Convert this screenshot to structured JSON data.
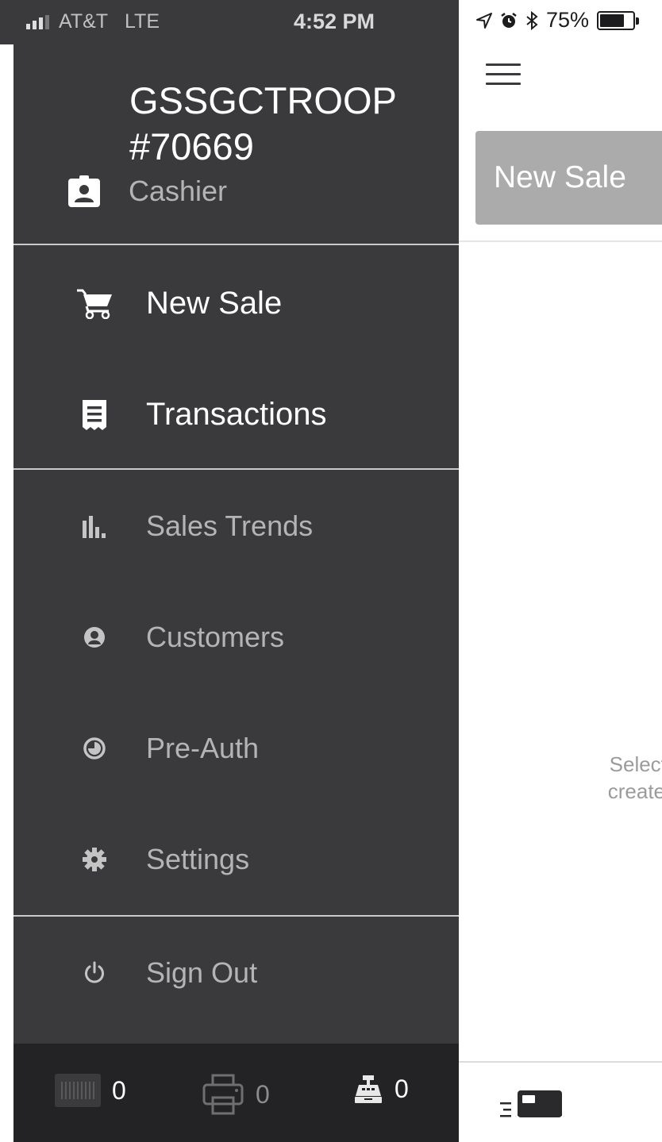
{
  "status_bar": {
    "carrier": "AT&T",
    "network": "LTE",
    "time": "4:52 PM",
    "battery_percent": "75%",
    "battery_level": 0.75
  },
  "main": {
    "active_tab": "New Sale",
    "hint_line1": "Select \"",
    "hint_line2": "create y"
  },
  "drawer": {
    "account_name": "GSSGCTROOP #70669",
    "role": "Cashier",
    "primary_items": [
      {
        "label": "New Sale",
        "icon": "cart-icon"
      },
      {
        "label": "Transactions",
        "icon": "receipt-icon"
      }
    ],
    "secondary_items": [
      {
        "label": "Sales Trends",
        "icon": "bar-chart-icon"
      },
      {
        "label": "Customers",
        "icon": "customer-icon"
      },
      {
        "label": "Pre-Auth",
        "icon": "pre-auth-icon"
      },
      {
        "label": "Settings",
        "icon": "gear-icon"
      }
    ],
    "sign_out": {
      "label": "Sign Out",
      "icon": "power-icon"
    },
    "footer": {
      "barcode_count": "0",
      "printer_count": "0",
      "register_count": "0"
    }
  },
  "colors": {
    "drawer_bg": "#3a3a3d",
    "footer_bg": "#232325",
    "tab_bg": "#ababab",
    "primary_text": "#ffffff",
    "secondary_text": "#b4b4b4"
  }
}
